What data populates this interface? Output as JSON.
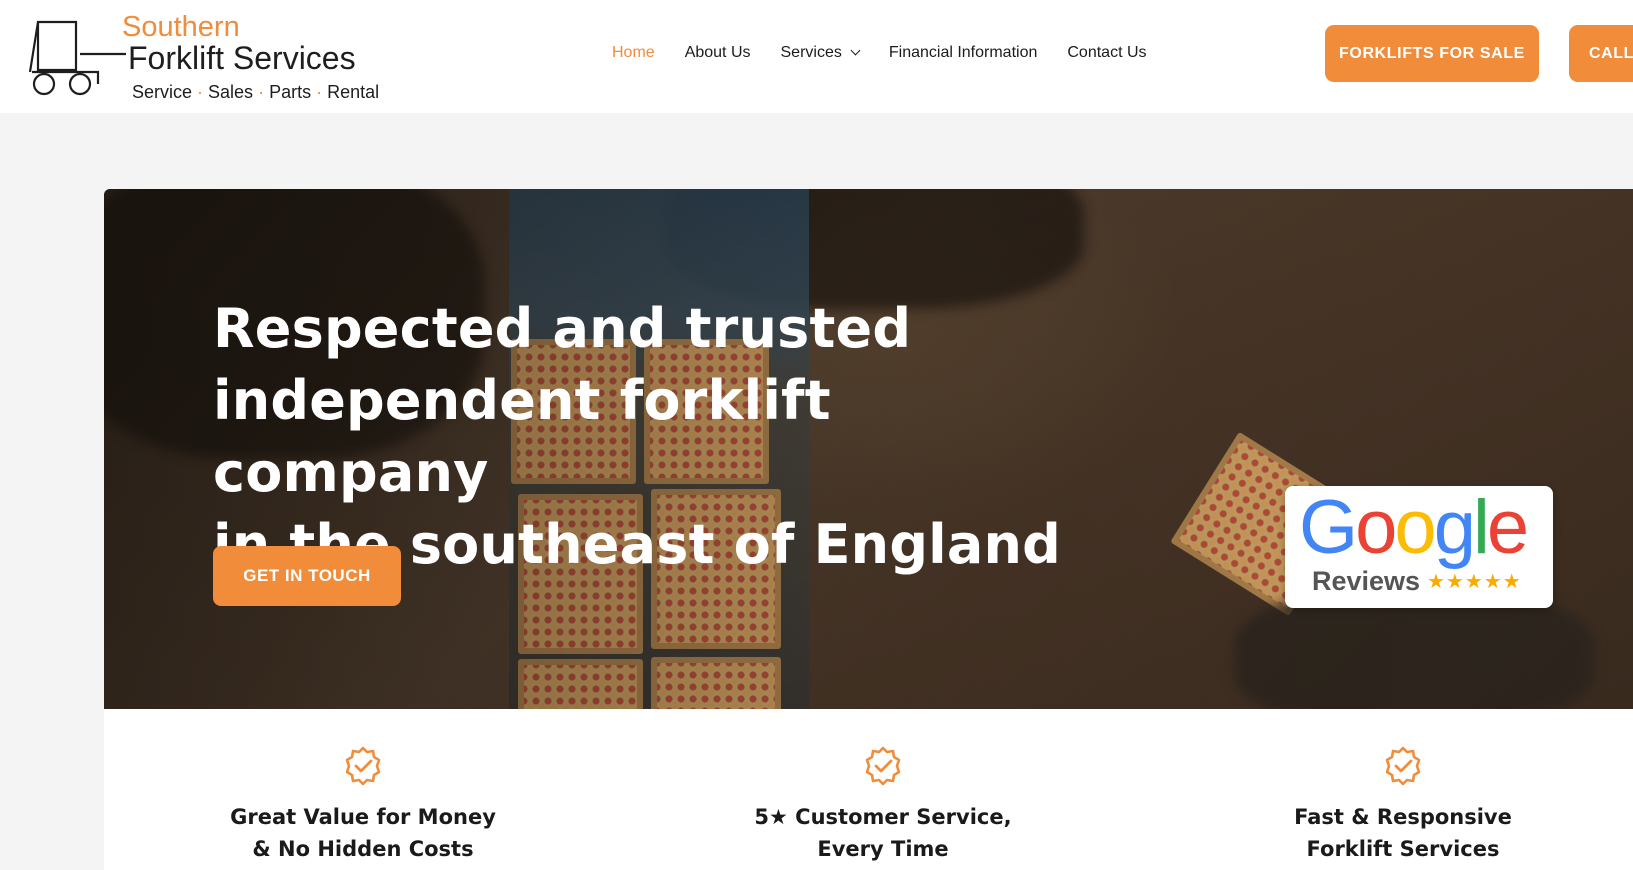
{
  "brand": {
    "line1": "Southern",
    "line2": "Forklift Services",
    "tagline": [
      "Service",
      "Sales",
      "Parts",
      "Rental"
    ],
    "accent_color": "#f08c3a"
  },
  "nav": {
    "items": [
      {
        "label": "Home",
        "active": true
      },
      {
        "label": "About Us"
      },
      {
        "label": "Services",
        "has_dropdown": true
      },
      {
        "label": "Financial Information"
      },
      {
        "label": "Contact Us"
      }
    ]
  },
  "header_buttons": {
    "forklifts_for_sale": "FORKLIFTS FOR SALE",
    "call": "CALL"
  },
  "hero": {
    "title_lines": [
      "Respected and trusted",
      "independent forklift company",
      "in the southeast of England"
    ],
    "cta": "GET IN TOUCH",
    "google_badge": {
      "wordmark": [
        "G",
        "o",
        "o",
        "g",
        "l",
        "e"
      ],
      "label": "Reviews",
      "stars": "★★★★★",
      "rating_stars": 5
    }
  },
  "features": [
    {
      "icon": "badge-check-icon",
      "lines": [
        "Great Value for Money",
        "& No Hidden Costs"
      ]
    },
    {
      "icon": "badge-check-icon",
      "lines": [
        "5★ Customer Service,",
        "Every Time"
      ]
    },
    {
      "icon": "badge-check-icon",
      "lines": [
        "Fast & Responsive",
        "Forklift Services"
      ]
    }
  ]
}
